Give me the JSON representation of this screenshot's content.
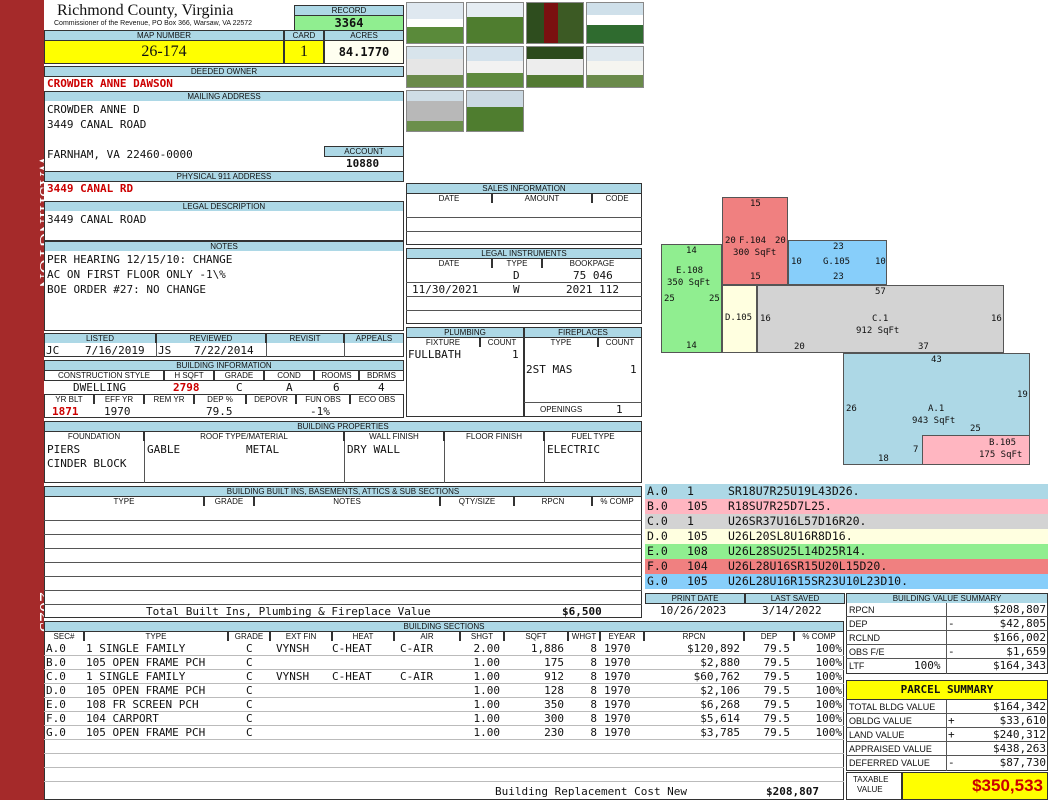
{
  "side": {
    "district": "WASHINGTON",
    "year": "2023"
  },
  "header": {
    "county": "Richmond County, Virginia",
    "commissioner": "Commissioner of the Revenue, PO Box 366, Warsaw, VA 22572",
    "record_label": "RECORD",
    "record": "3364",
    "map_label": "MAP NUMBER",
    "map": "26-174",
    "card_label": "CARD",
    "card": "1",
    "acres_label": "ACRES",
    "acres": "84.1770"
  },
  "owner": {
    "deeded_label": "DEEDED OWNER",
    "deeded": "CROWDER ANNE DAWSON",
    "mailing_label": "MAILING ADDRESS",
    "mail1": "CROWDER ANNE D",
    "mail2": "3449 CANAL ROAD",
    "mail3": "FARNHAM, VA 22460-0000",
    "account_label": "ACCOUNT",
    "account": "10880",
    "phys_label": "PHYSICAL 911 ADDRESS",
    "phys": "3449 CANAL RD",
    "legal_label": "LEGAL DESCRIPTION",
    "legal": "3449 CANAL ROAD",
    "notes_label": "NOTES",
    "note1": "PER HEARING 12/15/10: CHANGE",
    "note2": "AC ON FIRST FLOOR ONLY -1\\%",
    "note3": "BOE ORDER #27: NO CHANGE"
  },
  "review": {
    "listed_label": "LISTED",
    "listed_by": "JC",
    "listed": "7/16/2019",
    "reviewed_label": "REVIEWED",
    "reviewed_by": "JS",
    "reviewed": "7/22/2014",
    "revisit_label": "REVISIT",
    "appeals_label": "APPEALS"
  },
  "building": {
    "title": "BUILDING INFORMATION",
    "h_style": "CONSTRUCTION STYLE",
    "h_hsqft": "H SQFT",
    "h_grade": "GRADE",
    "h_cond": "COND",
    "h_rooms": "ROOMS",
    "h_bdrms": "BDRMS",
    "style": "DWELLING",
    "hsqft": "2798",
    "grade": "C",
    "cond": "A",
    "rooms": "6",
    "bdrms": "4",
    "h_yrblt": "YR BLT",
    "h_effyr": "EFF YR",
    "h_remyr": "REM YR",
    "h_dep": "DEP %",
    "h_depovr": "DEPOVR",
    "h_funobs": "FUN OBS",
    "h_ecoobs": "ECO OBS",
    "yrblt": "1871",
    "effyr": "1970",
    "dep": "79.5",
    "funobs": "-1%"
  },
  "props": {
    "title": "BUILDING PROPERTIES",
    "h_found": "FOUNDATION",
    "h_roof": "ROOF TYPE/MATERIAL",
    "h_wall": "WALL FINISH",
    "h_floor": "FLOOR FINISH",
    "h_fuel": "FUEL TYPE",
    "found1": "PIERS",
    "found2": "CINDER BLOCK",
    "roof_type": "GABLE",
    "roof_mat": "METAL",
    "wall": "DRY WALL",
    "fuel": "ELECTRIC"
  },
  "builtins": {
    "title": "BUILDING BUILT INS, BASEMENTS, ATTICS & SUB SECTIONS",
    "h_type": "TYPE",
    "h_grade": "GRADE",
    "h_notes": "NOTES",
    "h_qty": "QTY/SIZE",
    "h_rpcn": "RPCN",
    "h_comp": "% COMP",
    "total_label": "Total Built Ins, Plumbing & Fireplace Value",
    "total": "$6,500"
  },
  "sales": {
    "title": "SALES INFORMATION",
    "h_date": "DATE",
    "h_amount": "AMOUNT",
    "h_code": "CODE"
  },
  "legal_inst": {
    "title": "LEGAL INSTRUMENTS",
    "h_date": "DATE",
    "h_type": "TYPE",
    "h_book": "BOOKPAGE",
    "rows": [
      {
        "date": "",
        "type": "D",
        "book": "75 046"
      },
      {
        "date": "11/30/2021",
        "type": "W",
        "book": "2021 112"
      }
    ]
  },
  "plumbing": {
    "title": "PLUMBING",
    "h_fixture": "FIXTURE",
    "h_count": "COUNT",
    "fixture": "FULLBATH",
    "count": "1"
  },
  "fireplaces": {
    "title": "FIREPLACES",
    "h_type": "TYPE",
    "h_count": "COUNT",
    "type": "2ST MAS",
    "count": "1",
    "openings_label": "OPENINGS",
    "openings": "1"
  },
  "sketch": {
    "a_label": "A.1",
    "a_area": "943 SqFt",
    "b_label": "B.105",
    "b_area": "175 SqFt",
    "c_label": "C.1",
    "c_area": "912 SqFt",
    "d_label": "D.105",
    "e_label": "E.108",
    "e_area": "350 SqFt",
    "f_label": "F.104",
    "f_area": "300 SqFt",
    "g_label": "G.105",
    "d15a": "15",
    "d20a": "20",
    "d20b": "20",
    "d15b": "15",
    "d23a": "23",
    "d10a": "10",
    "d10b": "10",
    "d23b": "23",
    "d14a": "14",
    "d25a": "25",
    "d25b": "25",
    "d14b": "14",
    "d57": "57",
    "d16a": "16",
    "d16b": "16",
    "d20c": "20",
    "d37": "37",
    "d43": "43",
    "d19": "19",
    "d26": "26",
    "d25c": "25",
    "d7": "7",
    "d18": "18"
  },
  "codes": [
    {
      "sec": "A.0",
      "num": "1",
      "path": "SR18U7R25U19L43D26.",
      "color": "#add8e6"
    },
    {
      "sec": "B.0",
      "num": "105",
      "path": "R18SU7R25D7L25.",
      "color": "#ffb6c1"
    },
    {
      "sec": "C.0",
      "num": "1",
      "path": "U26SR37U16L57D16R20.",
      "color": "#d3d3d3"
    },
    {
      "sec": "D.0",
      "num": "105",
      "path": "U26L20SL8U16R8D16.",
      "color": "#ffffe0"
    },
    {
      "sec": "E.0",
      "num": "108",
      "path": "U26L28SU25L14D25R14.",
      "color": "#90ee90"
    },
    {
      "sec": "F.0",
      "num": "104",
      "path": "U26L28U16SR15U20L15D20.",
      "color": "#f08080"
    },
    {
      "sec": "G.0",
      "num": "105",
      "path": "U26L28U16R15SR23U10L23D10.",
      "color": "#87cefa"
    }
  ],
  "dates": {
    "print_label": "PRINT DATE",
    "print": "10/26/2023",
    "saved_label": "LAST SAVED",
    "saved": "3/14/2022"
  },
  "sections": {
    "title": "BUILDING SECTIONS",
    "h": {
      "sec": "SEC#",
      "type": "TYPE",
      "grade": "GRADE",
      "ext": "EXT FIN",
      "heat": "HEAT",
      "air": "AIR",
      "shgt": "SHGT",
      "sqft": "SQFT",
      "whgt": "WHGT",
      "eyear": "EYEAR",
      "rpcn": "RPCN",
      "dep": "DEP",
      "comp": "% COMP"
    },
    "rows": [
      {
        "sec": "A.0",
        "type": "1 SINGLE FAMILY",
        "grade": "C",
        "ext": "VYNSH",
        "heat": "C-HEAT",
        "air": "C-AIR",
        "shgt": "2.00",
        "sqft": "1,886",
        "whgt": "8",
        "eyear": "1970",
        "rpcn": "$120,892",
        "dep": "79.5",
        "comp": "100%"
      },
      {
        "sec": "B.0",
        "type": "105 OPEN FRAME PCH",
        "grade": "C",
        "ext": "",
        "heat": "",
        "air": "",
        "shgt": "1.00",
        "sqft": "175",
        "whgt": "8",
        "eyear": "1970",
        "rpcn": "$2,880",
        "dep": "79.5",
        "comp": "100%"
      },
      {
        "sec": "C.0",
        "type": "1 SINGLE FAMILY",
        "grade": "C",
        "ext": "VYNSH",
        "heat": "C-HEAT",
        "air": "C-AIR",
        "shgt": "1.00",
        "sqft": "912",
        "whgt": "8",
        "eyear": "1970",
        "rpcn": "$60,762",
        "dep": "79.5",
        "comp": "100%"
      },
      {
        "sec": "D.0",
        "type": "105 OPEN FRAME PCH",
        "grade": "C",
        "ext": "",
        "heat": "",
        "air": "",
        "shgt": "1.00",
        "sqft": "128",
        "whgt": "8",
        "eyear": "1970",
        "rpcn": "$2,106",
        "dep": "79.5",
        "comp": "100%"
      },
      {
        "sec": "E.0",
        "type": "108 FR SCREEN PCH",
        "grade": "C",
        "ext": "",
        "heat": "",
        "air": "",
        "shgt": "1.00",
        "sqft": "350",
        "whgt": "8",
        "eyear": "1970",
        "rpcn": "$6,268",
        "dep": "79.5",
        "comp": "100%"
      },
      {
        "sec": "F.0",
        "type": "104 CARPORT",
        "grade": "C",
        "ext": "",
        "heat": "",
        "air": "",
        "shgt": "1.00",
        "sqft": "300",
        "whgt": "8",
        "eyear": "1970",
        "rpcn": "$5,614",
        "dep": "79.5",
        "comp": "100%"
      },
      {
        "sec": "G.0",
        "type": "105 OPEN FRAME PCH",
        "grade": "C",
        "ext": "",
        "heat": "",
        "air": "",
        "shgt": "1.00",
        "sqft": "230",
        "whgt": "8",
        "eyear": "1970",
        "rpcn": "$3,785",
        "dep": "79.5",
        "comp": "100%"
      }
    ],
    "total_label": "Building Replacement Cost New",
    "total": "$208,807"
  },
  "bvs": {
    "title": "BUILDING VALUE SUMMARY",
    "rpcn_label": "RPCN",
    "rpcn": "$208,807",
    "dep_label": "DEP",
    "dep_sign": "-",
    "dep": "$42,805",
    "rclnd_label": "RCLND",
    "rclnd": "$166,002",
    "obs_label": "OBS F/E",
    "obs_sign": "-",
    "obs": "$1,659",
    "ltf_label": "LTF",
    "ltf_pct": "100%",
    "ltf": "$164,343"
  },
  "parcel": {
    "title": "PARCEL SUMMARY",
    "tbv_label": "TOTAL BLDG VALUE",
    "tbv": "$164,342",
    "obldg_label": "OBLDG VALUE",
    "obldg_sign": "+",
    "obldg": "$33,610",
    "land_label": "LAND VALUE",
    "land_sign": "+",
    "land": "$240,312",
    "appr_label": "APPRAISED VALUE",
    "appr": "$438,263",
    "def_label": "DEFERRED VALUE",
    "def_sign": "-",
    "def": "$87,730",
    "taxable_label1": "TAXABLE",
    "taxable_label2": "VALUE",
    "taxable": "$350,533"
  }
}
